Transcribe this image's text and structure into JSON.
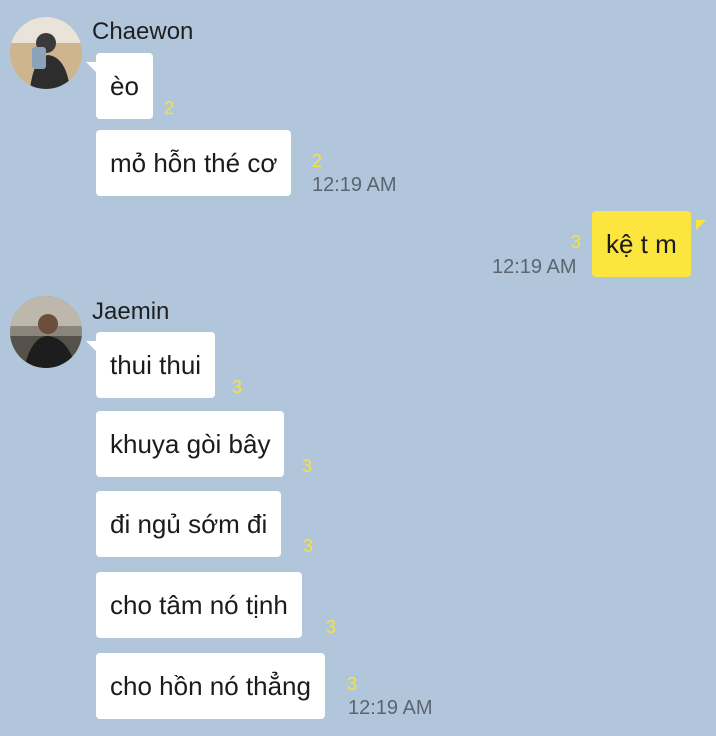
{
  "chat": {
    "groups": [
      {
        "sender": "Chaewon",
        "avatar_icon": "user-avatar-photo",
        "messages": [
          {
            "text": "èo",
            "unread": "2"
          },
          {
            "text": "mỏ hỗn thé cơ",
            "unread": "2",
            "time": "12:19 AM"
          }
        ]
      },
      {
        "sender": "me",
        "messages": [
          {
            "text": "kệ t m",
            "unread": "3",
            "time": "12:19 AM"
          }
        ]
      },
      {
        "sender": "Jaemin",
        "avatar_icon": "user-avatar-photo",
        "messages": [
          {
            "text": "thui thui",
            "unread": "3"
          },
          {
            "text": "khuya gòi bây",
            "unread": "3"
          },
          {
            "text": "đi ngủ sớm đi",
            "unread": "3"
          },
          {
            "text": "cho tâm nó tịnh",
            "unread": "3"
          },
          {
            "text": "cho hồn nó thẳng",
            "unread": "3",
            "time": "12:19 AM"
          }
        ]
      }
    ]
  },
  "colors": {
    "background": "#b1c6db",
    "incoming_bubble": "#ffffff",
    "outgoing_bubble": "#fde540",
    "unread_count": "#f6e33a",
    "timestamp": "#5b6570"
  }
}
